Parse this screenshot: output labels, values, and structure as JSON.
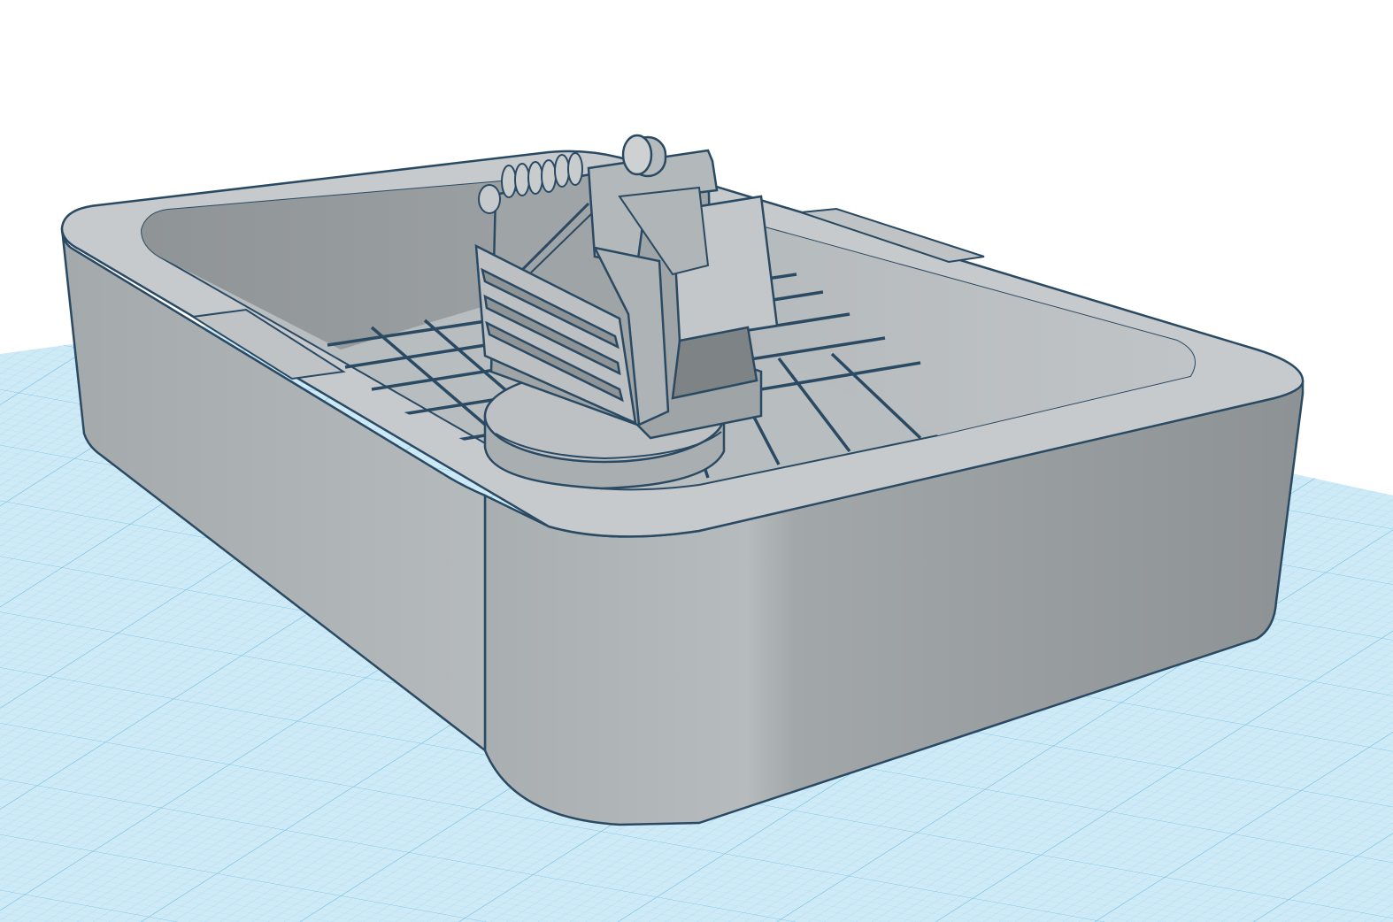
{
  "app": {
    "view": "3d-workplane",
    "icon": "workplane-grid-icon"
  },
  "scene": {
    "background_color": "#ffffff",
    "workplane_color": "#cfeaf7",
    "workplane_grid_minor_color": "#9fd3ec",
    "workplane_grid_major_color": "#6fbde2",
    "model_color": "#b4b9bb",
    "model_edge_color": "#2a4a63",
    "objects": [
      {
        "name": "tray-body",
        "icon": "rounded-box-icon"
      },
      {
        "name": "floor-grid",
        "icon": "grid-icon"
      },
      {
        "name": "turret-base",
        "icon": "cylinder-icon"
      },
      {
        "name": "turret-assembly",
        "icon": "turret-icon"
      }
    ]
  }
}
